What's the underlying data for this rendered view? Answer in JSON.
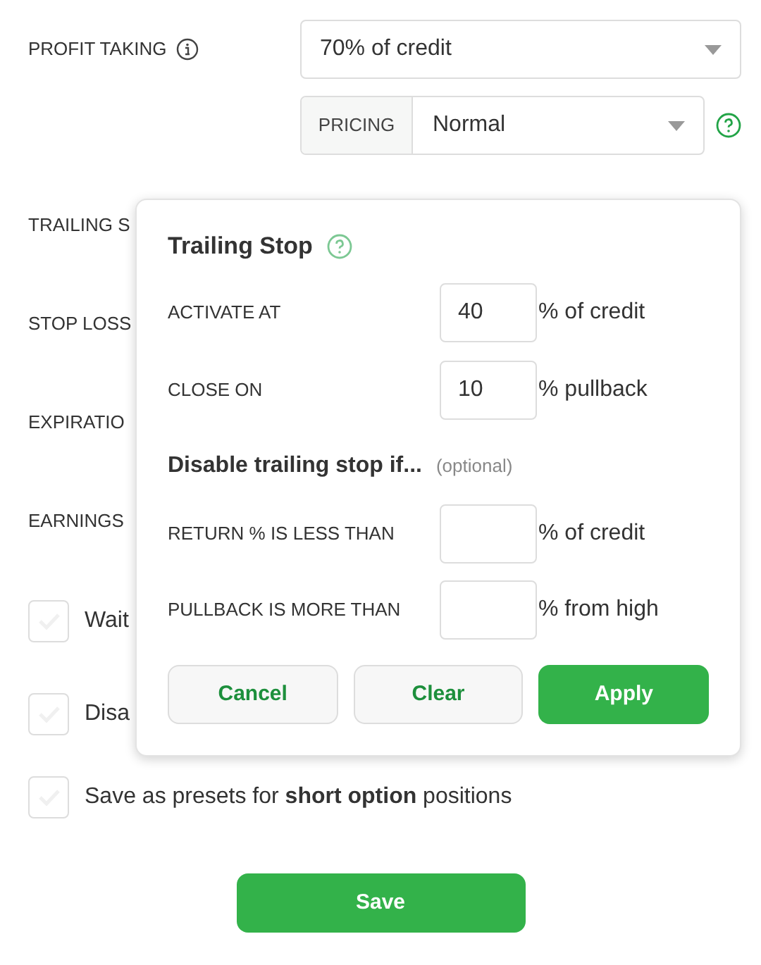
{
  "form": {
    "profit_taking": {
      "label": "PROFIT TAKING",
      "value": "70% of credit"
    },
    "pricing": {
      "label": "PRICING",
      "value": "Normal"
    },
    "rows": [
      {
        "label": "TRAILING S"
      },
      {
        "label": "STOP LOSS"
      },
      {
        "label": "EXPIRATIO"
      },
      {
        "label": "EARNINGS"
      }
    ],
    "checkboxes": [
      {
        "label": "Wait",
        "checked": false
      },
      {
        "label": "Disa",
        "checked": false
      },
      {
        "label": "Save as presets for **short option** positions",
        "checked": false
      }
    ],
    "save_button": "Save"
  },
  "popover": {
    "title": "Trailing Stop",
    "fields": [
      {
        "label": "ACTIVATE AT",
        "value": "40",
        "unit": "% of credit"
      },
      {
        "label": "CLOSE ON",
        "value": "10",
        "unit": "% pullback"
      }
    ],
    "disable_heading": "Disable trailing stop if...",
    "optional_note": "(optional)",
    "disable_fields": [
      {
        "label": "RETURN % IS LESS THAN",
        "unit": "% of credit"
      },
      {
        "label": "PULLBACK IS MORE THAN",
        "unit": "% from high"
      }
    ],
    "buttons": [
      {
        "label": "Cancel",
        "kind": "secondary"
      },
      {
        "label": "Clear",
        "kind": "secondary"
      },
      {
        "label": "Apply",
        "kind": "primary"
      }
    ]
  }
}
